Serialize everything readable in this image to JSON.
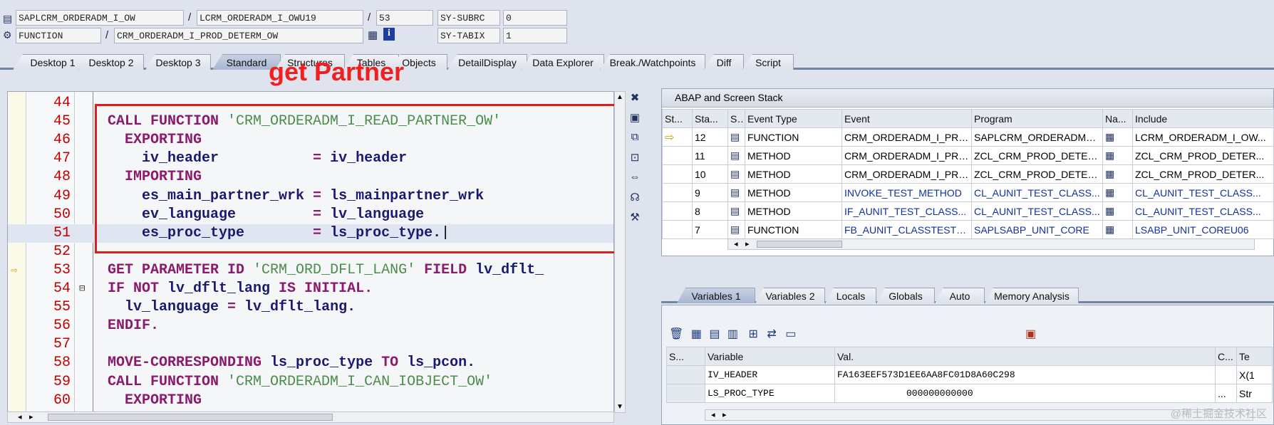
{
  "header": {
    "row1": {
      "program": "SAPLCRM_ORDERADM_I_OW",
      "include": "LCRM_ORDERADM_I_OWU19",
      "line": "53",
      "sy_label": "SY-SUBRC",
      "sy_value": "0"
    },
    "row2": {
      "event_type": "FUNCTION",
      "event": "CRM_ORDERADM_I_PROD_DETERM_OW",
      "sy_label": "SY-TABIX",
      "sy_value": "1"
    }
  },
  "tabs": [
    "Desktop 1",
    "Desktop 2",
    "Desktop 3",
    "Standard",
    "Structures",
    "Tables",
    "Objects",
    "DetailDisplay",
    "Data Explorer",
    "Break./Watchpoints",
    "Diff",
    "Script"
  ],
  "overlay_text": "get Partner",
  "code": [
    {
      "n": "44",
      "parts": []
    },
    {
      "n": "45",
      "parts": [
        {
          "t": "CALL FUNCTION ",
          "c": "kw"
        },
        {
          "t": "'CRM_ORDERADM_I_READ_PARTNER_OW'",
          "c": "str"
        }
      ]
    },
    {
      "n": "46",
      "parts": [
        {
          "t": "  EXPORTING",
          "c": "kw"
        }
      ]
    },
    {
      "n": "47",
      "parts": [
        {
          "t": "    iv_header           ",
          "c": "var"
        },
        {
          "t": "= ",
          "c": "kw"
        },
        {
          "t": "iv_header",
          "c": "var"
        }
      ]
    },
    {
      "n": "48",
      "parts": [
        {
          "t": "  IMPORTING",
          "c": "kw"
        }
      ]
    },
    {
      "n": "49",
      "parts": [
        {
          "t": "    es_main_partner_wrk ",
          "c": "var"
        },
        {
          "t": "= ",
          "c": "kw"
        },
        {
          "t": "ls_mainpartner_wrk",
          "c": "var"
        }
      ]
    },
    {
      "n": "50",
      "parts": [
        {
          "t": "    ev_language         ",
          "c": "var"
        },
        {
          "t": "= ",
          "c": "kw"
        },
        {
          "t": "lv_language",
          "c": "var"
        }
      ]
    },
    {
      "n": "51",
      "parts": [
        {
          "t": "    es_proc_type        ",
          "c": "var"
        },
        {
          "t": "= ",
          "c": "kw"
        },
        {
          "t": "ls_proc_type.",
          "c": "var"
        }
      ]
    },
    {
      "n": "52",
      "parts": []
    },
    {
      "n": "53",
      "parts": [
        {
          "t": "GET PARAMETER ID ",
          "c": "kw"
        },
        {
          "t": "'CRM_ORD_DFLT_LANG'",
          "c": "str"
        },
        {
          "t": " FIELD ",
          "c": "kw"
        },
        {
          "t": "lv_dflt_",
          "c": "var"
        }
      ]
    },
    {
      "n": "54",
      "parts": [
        {
          "t": "IF NOT ",
          "c": "kw"
        },
        {
          "t": "lv_dflt_lang ",
          "c": "var"
        },
        {
          "t": "IS INITIAL.",
          "c": "kw"
        }
      ]
    },
    {
      "n": "55",
      "parts": [
        {
          "t": "  lv_language ",
          "c": "var"
        },
        {
          "t": "= ",
          "c": "kw"
        },
        {
          "t": "lv_dflt_lang.",
          "c": "var"
        }
      ]
    },
    {
      "n": "56",
      "parts": [
        {
          "t": "ENDIF.",
          "c": "kw"
        }
      ]
    },
    {
      "n": "57",
      "parts": []
    },
    {
      "n": "58",
      "parts": [
        {
          "t": "MOVE-CORRESPONDING ",
          "c": "kw"
        },
        {
          "t": "ls_proc_type ",
          "c": "var"
        },
        {
          "t": "TO ",
          "c": "kw"
        },
        {
          "t": "ls_pcon.",
          "c": "var"
        }
      ]
    },
    {
      "n": "59",
      "parts": [
        {
          "t": "CALL FUNCTION ",
          "c": "kw"
        },
        {
          "t": "'CRM_ORDERADM_I_CAN_IOBJECT_OW'",
          "c": "str"
        }
      ]
    },
    {
      "n": "60",
      "parts": [
        {
          "t": "  EXPORTING",
          "c": "kw"
        }
      ]
    }
  ],
  "stack": {
    "title": "ABAP and Screen Stack",
    "columns": [
      "St...",
      "Sta...",
      "S...",
      "Event Type",
      "Event",
      "Program",
      "Na...",
      "Include"
    ],
    "rows": [
      {
        "level": "12",
        "type": "FUNCTION",
        "event": "CRM_ORDERADM_I_PRO...",
        "program": "SAPLCRM_ORDERADM_I...",
        "include": "LCRM_ORDERADM_I_OW...",
        "current": true
      },
      {
        "level": "11",
        "type": "METHOD",
        "event": "CRM_ORDERADM_I_PRO...",
        "program": "ZCL_CRM_PROD_DETER...",
        "include": "ZCL_CRM_PROD_DETER...",
        "current": false
      },
      {
        "level": "10",
        "type": "METHOD",
        "event": "CRM_ORDERADM_I_PRO...",
        "program": "ZCL_CRM_PROD_DETER...",
        "include": "ZCL_CRM_PROD_DETER...",
        "current": false
      },
      {
        "level": "9",
        "type": "METHOD",
        "event": "INVOKE_TEST_METHOD",
        "program": "CL_AUNIT_TEST_CLASS...",
        "include": "CL_AUNIT_TEST_CLASS...",
        "current": false
      },
      {
        "level": "8",
        "type": "METHOD",
        "event": "IF_AUNIT_TEST_CLASS...",
        "program": "CL_AUNIT_TEST_CLASS...",
        "include": "CL_AUNIT_TEST_CLASS...",
        "current": false
      },
      {
        "level": "7",
        "type": "FUNCTION",
        "event": "FB_AUNIT_CLASSTEST_...",
        "program": "SAPLSABP_UNIT_CORE",
        "include": "LSABP_UNIT_COREU06",
        "current": false
      }
    ]
  },
  "var_tabs": [
    "Variables 1",
    "Variables 2",
    "Locals",
    "Globals",
    "Auto",
    "Memory Analysis"
  ],
  "variables": {
    "columns": [
      "S...",
      "Variable",
      "Val.",
      "C...",
      "Te"
    ],
    "rows": [
      {
        "name": "IV_HEADER",
        "value": "FA163EEF573D1EE6AA8FC01D8A60C298",
        "type": "X(1"
      },
      {
        "name": "LS_PROC_TYPE",
        "value": "000000000000",
        "value_extra": "...",
        "type": "Str"
      }
    ]
  },
  "watermark": "@稀土掘金技术社区",
  "colors": {
    "keyword": "#8b1a6b",
    "string": "#4c8c4c",
    "variable": "#1a1a70",
    "highlight_box": "#d92020",
    "line_number": "#c00000"
  }
}
